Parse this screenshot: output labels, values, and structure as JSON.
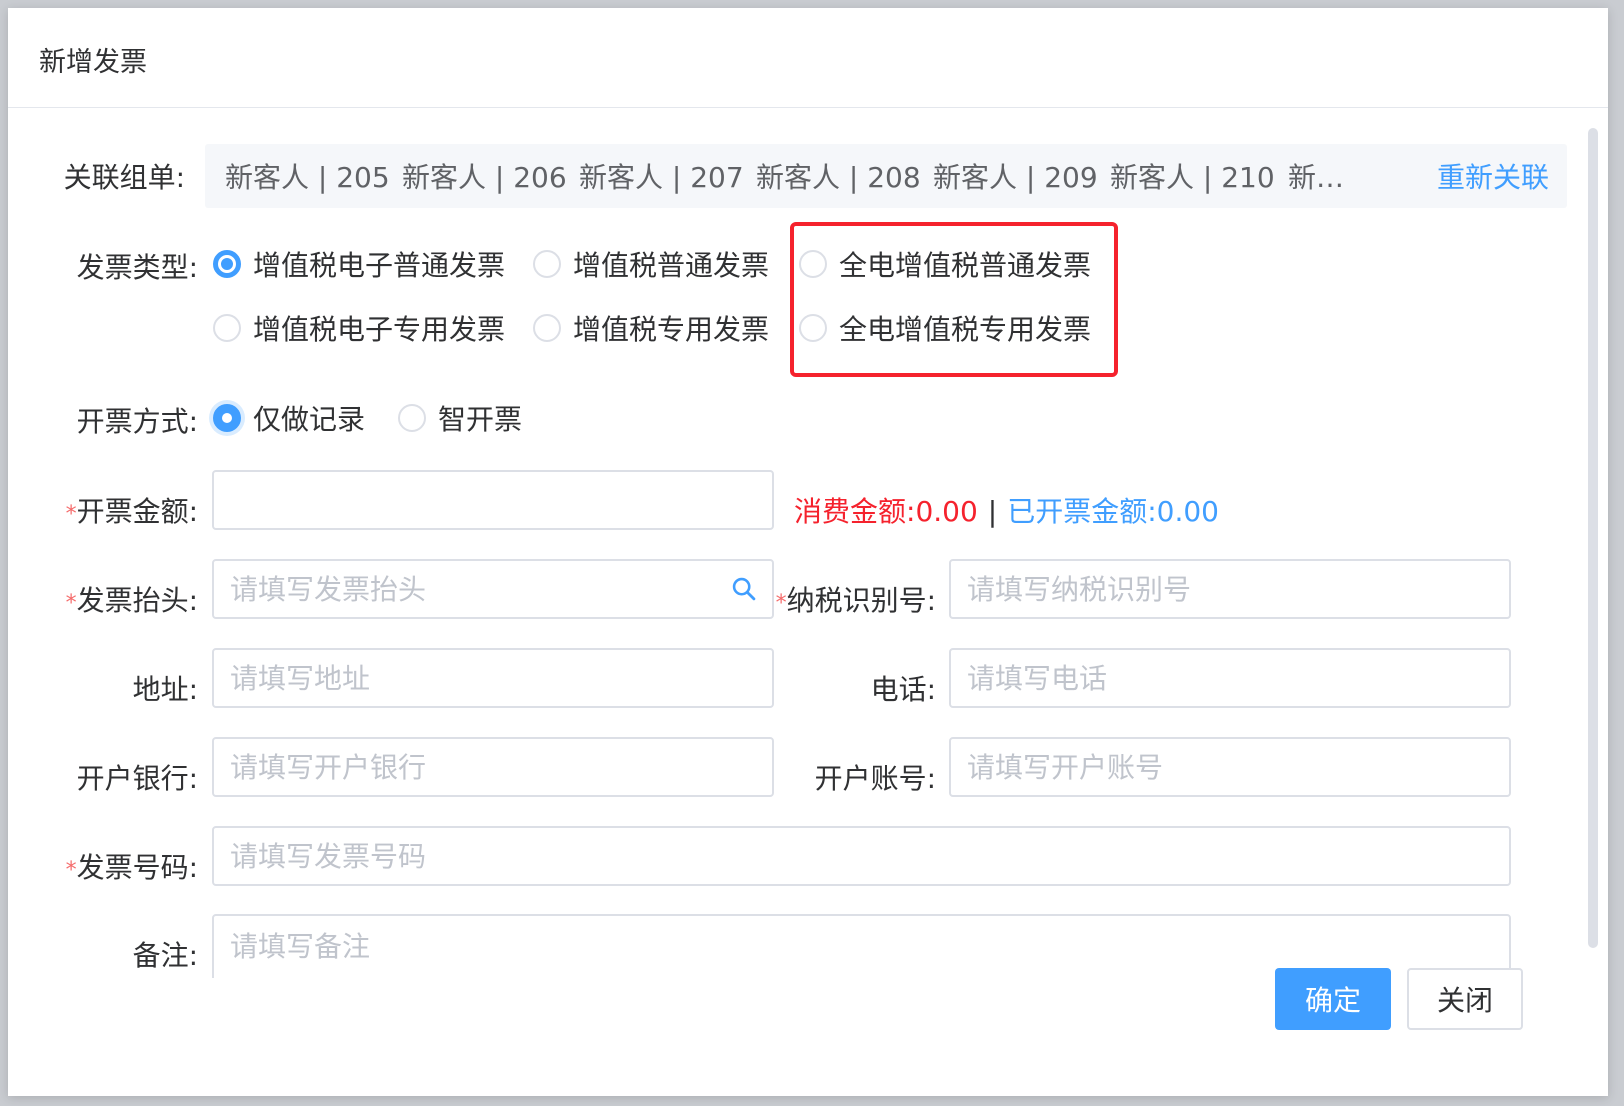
{
  "dialog": {
    "title": "新增发票",
    "confirm_label": "确定",
    "close_label": "关闭"
  },
  "linked_orders": {
    "label": "关联组单:",
    "items": [
      "新客人 | 205",
      "新客人 | 206",
      "新客人 | 207",
      "新客人 | 208",
      "新客人 | 209",
      "新客人 | 210",
      "新…"
    ],
    "relink_label": "重新关联"
  },
  "invoice_type": {
    "label": "发票类型:",
    "options": [
      "增值税电子普通发票",
      "增值税普通发票",
      "全电增值税普通发票",
      "增值税电子专用发票",
      "增值税专用发票",
      "全电增值税专用发票"
    ],
    "selected": "增值税电子普通发票"
  },
  "issue_method": {
    "label": "开票方式:",
    "options": [
      "仅做记录",
      "智开票"
    ],
    "selected": "仅做记录"
  },
  "amount": {
    "label": "开票金额:",
    "value": "",
    "consumed_label": "消费金额:",
    "consumed_value": "0.00",
    "separator": "|",
    "issued_label": "已开票金额:",
    "issued_value": "0.00"
  },
  "fields": {
    "title": {
      "label": "发票抬头:",
      "placeholder": "请填写发票抬头"
    },
    "tax_id": {
      "label": "纳税识别号:",
      "placeholder": "请填写纳税识别号"
    },
    "address": {
      "label": "地址:",
      "placeholder": "请填写地址"
    },
    "phone": {
      "label": "电话:",
      "placeholder": "请填写电话"
    },
    "bank": {
      "label": "开户银行:",
      "placeholder": "请填写开户银行"
    },
    "account": {
      "label": "开户账号:",
      "placeholder": "请填写开户账号"
    },
    "invoice_no": {
      "label": "发票号码:",
      "placeholder": "请填写发票号码"
    },
    "remark": {
      "label": "备注:",
      "placeholder": "请填写备注"
    }
  },
  "required_mark": "*",
  "colors": {
    "primary": "#409eff",
    "danger": "#f5222d",
    "border": "#dcdfe6"
  },
  "icons": {
    "search": "search-icon"
  }
}
